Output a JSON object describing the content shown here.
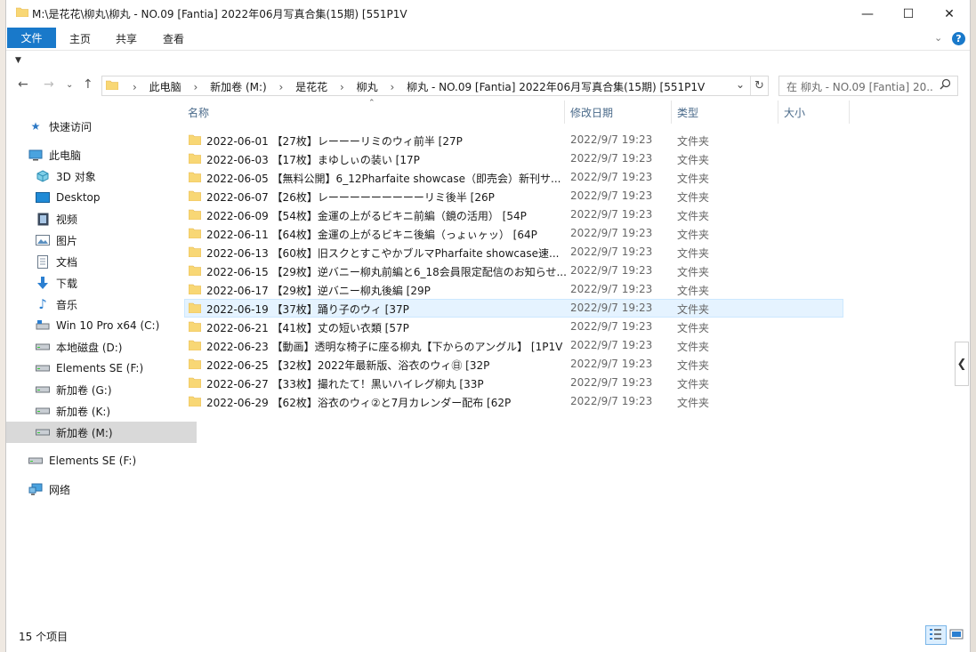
{
  "window": {
    "title": "M:\\是花花\\柳丸\\柳丸 - NO.09 [Fantia] 2022年06月写真合集(15期) [551P1V",
    "minimize_label": "—",
    "maximize_label": "☐",
    "close_label": "✕"
  },
  "ribbon": {
    "file_tab": "文件",
    "tabs": [
      "主页",
      "共享",
      "查看"
    ],
    "help_label": "?"
  },
  "address": {
    "crumbs": [
      "此电脑",
      "新加卷 (M:)",
      "是花花",
      "柳丸",
      "柳丸 - NO.09 [Fantia] 2022年06月写真合集(15期) [551P1V"
    ],
    "search_placeholder": "在 柳丸 - NO.09 [Fantia] 20..."
  },
  "sidebar": {
    "items": [
      {
        "label": "快速访问",
        "icon": "star-icon"
      },
      {
        "label": "此电脑",
        "icon": "computer-icon"
      },
      {
        "label": "3D 对象",
        "icon": "cube-icon"
      },
      {
        "label": "Desktop",
        "icon": "desktop-icon"
      },
      {
        "label": "视频",
        "icon": "video-icon"
      },
      {
        "label": "图片",
        "icon": "picture-icon"
      },
      {
        "label": "文档",
        "icon": "document-icon"
      },
      {
        "label": "下载",
        "icon": "download-icon"
      },
      {
        "label": "音乐",
        "icon": "music-icon"
      },
      {
        "label": "Win 10 Pro x64 (C:)",
        "icon": "system-drive-icon"
      },
      {
        "label": "本地磁盘 (D:)",
        "icon": "drive-icon"
      },
      {
        "label": "Elements SE (F:)",
        "icon": "drive-icon"
      },
      {
        "label": "新加卷 (G:)",
        "icon": "drive-icon"
      },
      {
        "label": "新加卷 (K:)",
        "icon": "drive-icon"
      },
      {
        "label": "新加卷 (M:)",
        "icon": "drive-icon"
      },
      {
        "label": "Elements SE (F:)",
        "icon": "drive-icon"
      },
      {
        "label": "网络",
        "icon": "network-icon"
      }
    ]
  },
  "columns": {
    "name": "名称",
    "date": "修改日期",
    "type": "类型",
    "size": "大小"
  },
  "files": [
    {
      "name": "2022-06-01 【27枚】レーーーリミのウィ前半 [27P",
      "date": "2022/9/7 19:23",
      "type": "文件夹"
    },
    {
      "name": "2022-06-03 【17枚】まゆしぃの装い [17P",
      "date": "2022/9/7 19:23",
      "type": "文件夹"
    },
    {
      "name": "2022-06-05 【無料公開】6_12Pharfaite showcase（即売会）新刊サ...",
      "date": "2022/9/7 19:23",
      "type": "文件夹"
    },
    {
      "name": "2022-06-07 【26枚】レーーーーーーーーーリミ後半 [26P",
      "date": "2022/9/7 19:23",
      "type": "文件夹"
    },
    {
      "name": "2022-06-09 【54枚】金運の上がるビキニ前編（鏡の活用） [54P",
      "date": "2022/9/7 19:23",
      "type": "文件夹"
    },
    {
      "name": "2022-06-11 【64枚】金運の上がるビキニ後編（っょぃヶッ） [64P",
      "date": "2022/9/7 19:23",
      "type": "文件夹"
    },
    {
      "name": "2022-06-13 【60枚】旧スクとすこやかブルマPharfaite showcase速...",
      "date": "2022/9/7 19:23",
      "type": "文件夹"
    },
    {
      "name": "2022-06-15 【29枚】逆バニー柳丸前編と6_18会員限定配信のお知らせ...",
      "date": "2022/9/7 19:23",
      "type": "文件夹"
    },
    {
      "name": "2022-06-17 【29枚】逆バニー柳丸後編 [29P",
      "date": "2022/9/7 19:23",
      "type": "文件夹"
    },
    {
      "name": "2022-06-19 【37枚】踊り子のウィ [37P",
      "date": "2022/9/7 19:23",
      "type": "文件夹"
    },
    {
      "name": "2022-06-21 【41枚】丈の短い衣類 [57P",
      "date": "2022/9/7 19:23",
      "type": "文件夹"
    },
    {
      "name": "2022-06-23 【動画】透明な椅子に座る柳丸【下からのアングル】 [1P1V",
      "date": "2022/9/7 19:23",
      "type": "文件夹"
    },
    {
      "name": "2022-06-25 【32枚】2022年最新版、浴衣のウィ㊐ [32P",
      "date": "2022/9/7 19:23",
      "type": "文件夹"
    },
    {
      "name": "2022-06-27 【33枚】撮れたて！黒いハイレグ柳丸 [33P",
      "date": "2022/9/7 19:23",
      "type": "文件夹"
    },
    {
      "name": "2022-06-29 【62枚】浴衣のウィ②と7月カレンダー配布 [62P",
      "date": "2022/9/7 19:23",
      "type": "文件夹"
    }
  ],
  "status": {
    "count": "15 个项目"
  },
  "colors": {
    "accent": "#1979ca",
    "folder": "#f8d775",
    "folder_edge": "#e5b54a",
    "hover_row": "#e5f3ff",
    "selected_nav": "#d9d9d9"
  }
}
